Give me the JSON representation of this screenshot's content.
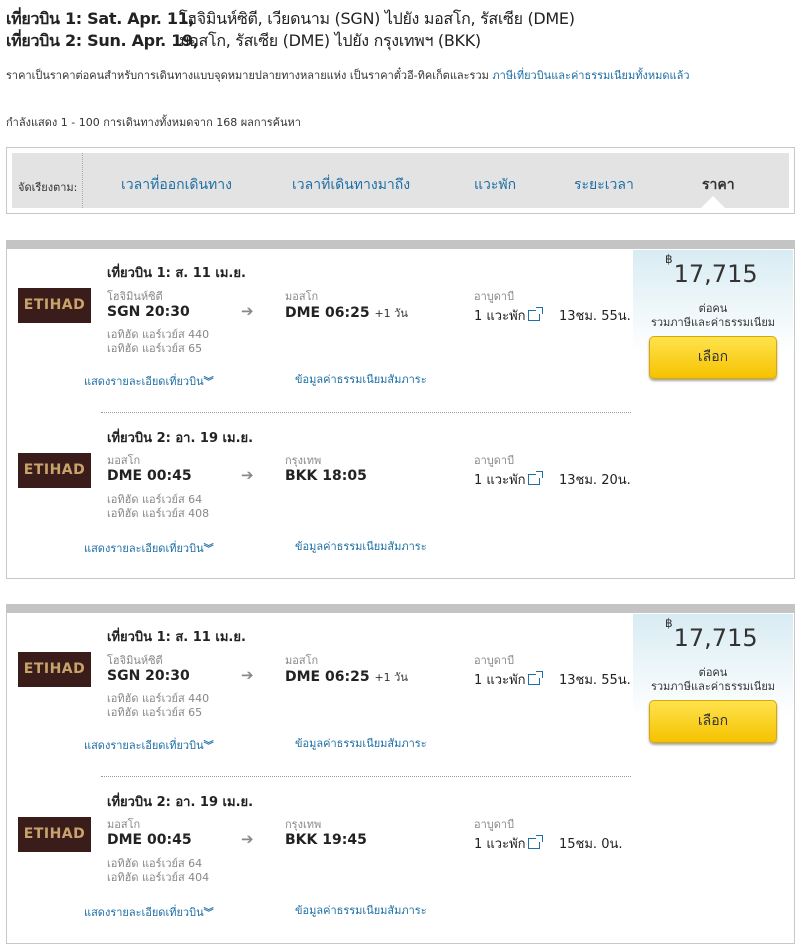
{
  "header": {
    "rows": [
      {
        "label": "เที่ยวบิน 1: Sat. Apr. 11,",
        "route": "โฮจิมินห์ซิตี, เวียดนาม (SGN) ไปยัง มอสโก, รัสเซีย (DME)"
      },
      {
        "label": "เที่ยวบิน 2: Sun. Apr. 19,",
        "route": "มอสโก, รัสเซีย (DME) ไปยัง กรุงเทพฯ (BKK)"
      }
    ]
  },
  "note": {
    "text": "ราคาเป็นราคาต่อคนสำหรับการเดินทางแบบจุดหมายปลายทางหลายแห่ง เป็นราคาตั๋วอี-ทิคเก็ตและรวม ",
    "link": "ภาษีเที่ยวบินและค่าธรรมเนียมทั้งหมดแล้ว"
  },
  "count": "กำลังแสดง 1 - 100 การเดินทางทั้งหมดจาก 168 ผลการค้นหา",
  "sort": {
    "label": "จัดเรียงตาม:",
    "options": [
      "เวลาที่ออกเดินทาง",
      "เวลาที่เดินทางมาถึง",
      "แวะพัก",
      "ระยะเวลา",
      "ราคา"
    ],
    "active": "ราคา"
  },
  "colors": {
    "link": "#1d6fa5",
    "button": "#f5c200",
    "logo_bg": "#3a1d1b"
  },
  "results": [
    {
      "price": "17,715",
      "currency": "฿",
      "per_person": "ต่อคน",
      "incl_tax": "รวมภาษีและค่าธรรมเนียม",
      "select_label": "เลือก",
      "legs": [
        {
          "title": "เที่ยวบิน 1: ส. 11 เม.ย.",
          "airline_logo": "ETIHAD",
          "from_city": "โฮจิมินห์ซิตี",
          "from_code": "SGN",
          "dep_time": "20:30",
          "to_city": "มอสโก",
          "to_code": "DME",
          "arr_time": "06:25",
          "day_offset": "+1 วัน",
          "flights": [
            "เอทิฮัด แอร์เวย์ส 440",
            "เอทิฮัด แอร์เวย์ส 65"
          ],
          "stop_city": "อาบูดาบี",
          "stops": "1 แวะพัก",
          "duration": "13ชม. 55น.",
          "details_link": "แสดงรายละเอียดเที่ยวบิน",
          "fees_link": "ข้อมูลค่าธรรมเนียมสัมภาระ"
        },
        {
          "title": "เที่ยวบิน 2: อา. 19 เม.ย.",
          "airline_logo": "ETIHAD",
          "from_city": "มอสโก",
          "from_code": "DME",
          "dep_time": "00:45",
          "to_city": "กรุงเทพ",
          "to_code": "BKK",
          "arr_time": "18:05",
          "day_offset": "",
          "flights": [
            "เอทิฮัด แอร์เวย์ส 64",
            "เอทิฮัด แอร์เวย์ส 408"
          ],
          "stop_city": "อาบูดาบี",
          "stops": "1 แวะพัก",
          "duration": "13ชม. 20น.",
          "details_link": "แสดงรายละเอียดเที่ยวบิน",
          "fees_link": "ข้อมูลค่าธรรมเนียมสัมภาระ"
        }
      ]
    },
    {
      "price": "17,715",
      "currency": "฿",
      "per_person": "ต่อคน",
      "incl_tax": "รวมภาษีและค่าธรรมเนียม",
      "select_label": "เลือก",
      "legs": [
        {
          "title": "เที่ยวบิน 1: ส. 11 เม.ย.",
          "airline_logo": "ETIHAD",
          "from_city": "โฮจิมินห์ซิตี",
          "from_code": "SGN",
          "dep_time": "20:30",
          "to_city": "มอสโก",
          "to_code": "DME",
          "arr_time": "06:25",
          "day_offset": "+1 วัน",
          "flights": [
            "เอทิฮัด แอร์เวย์ส 440",
            "เอทิฮัด แอร์เวย์ส 65"
          ],
          "stop_city": "อาบูดาบี",
          "stops": "1 แวะพัก",
          "duration": "13ชม. 55น.",
          "details_link": "แสดงรายละเอียดเที่ยวบิน",
          "fees_link": "ข้อมูลค่าธรรมเนียมสัมภาระ"
        },
        {
          "title": "เที่ยวบิน 2: อา. 19 เม.ย.",
          "airline_logo": "ETIHAD",
          "from_city": "มอสโก",
          "from_code": "DME",
          "dep_time": "00:45",
          "to_city": "กรุงเทพ",
          "to_code": "BKK",
          "arr_time": "19:45",
          "day_offset": "",
          "flights": [
            "เอทิฮัด แอร์เวย์ส 64",
            "เอทิฮัด แอร์เวย์ส 404"
          ],
          "stop_city": "อาบูดาบี",
          "stops": "1 แวะพัก",
          "duration": "15ชม. 0น.",
          "details_link": "แสดงรายละเอียดเที่ยวบิน",
          "fees_link": "ข้อมูลค่าธรรมเนียมสัมภาระ"
        }
      ]
    }
  ]
}
